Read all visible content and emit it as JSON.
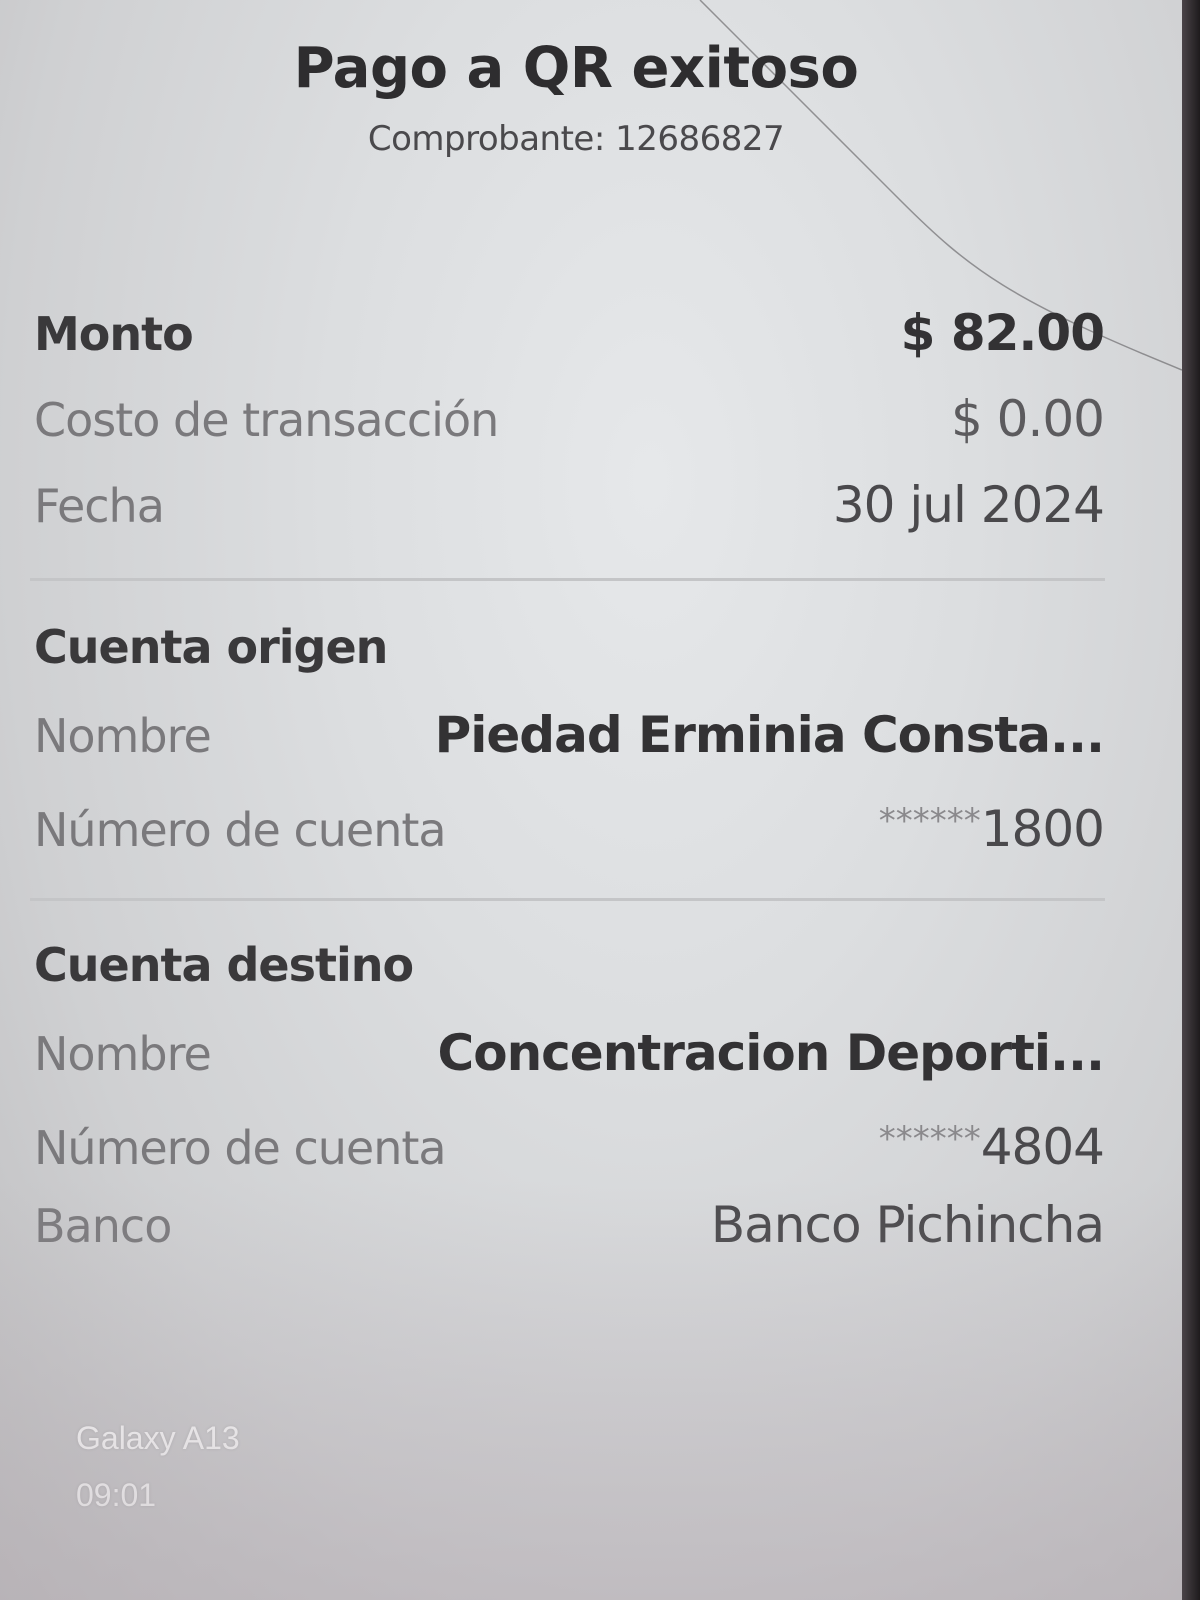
{
  "header": {
    "title": "Pago a QR exitoso",
    "receipt": "Comprobante: 12686827"
  },
  "summary": {
    "amount_label": "Monto",
    "amount_value": "$ 82.00",
    "fee_label": "Costo de transacción",
    "fee_value": "$ 0.00",
    "date_label": "Fecha",
    "date_value": "30 jul 2024"
  },
  "origin": {
    "title": "Cuenta origen",
    "name_label": "Nombre",
    "name_value": "Piedad Erminia Consta...",
    "account_label": "Número de cuenta",
    "account_mask": "******",
    "account_last4": "1800"
  },
  "destination": {
    "title": "Cuenta destino",
    "name_label": "Nombre",
    "name_value": "Concentracion Deporti...",
    "account_label": "Número de cuenta",
    "account_mask": "******",
    "account_last4": "4804",
    "bank_label": "Banco",
    "bank_value": "Banco Pichincha"
  },
  "watermark": {
    "device": "Galaxy A13",
    "time": "09:01"
  },
  "colors": {
    "screen_background": "#dcdee0",
    "title_text": "#2e2d2f",
    "label_text": "#7a797c",
    "divider": "#c4c5c7",
    "bezel": "#2b2a2c"
  }
}
